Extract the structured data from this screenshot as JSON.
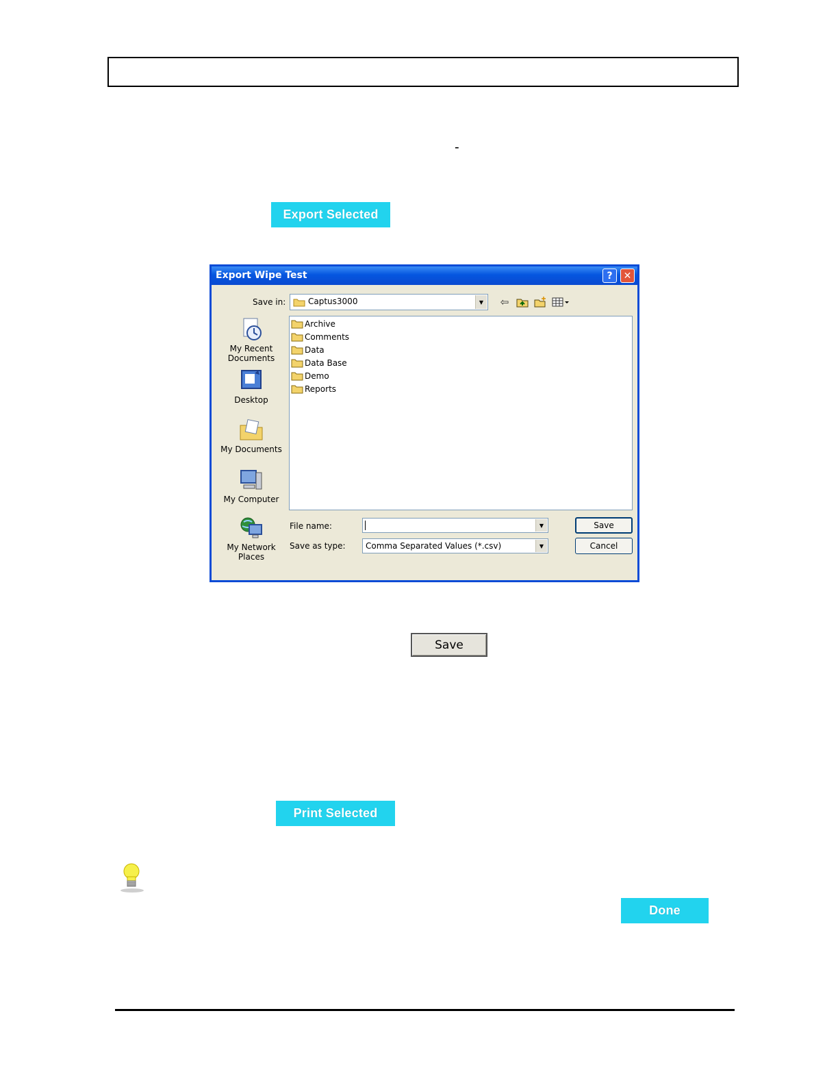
{
  "page": {
    "dash": "-",
    "export_selected_label": "Export Selected",
    "print_selected_label": "Print Selected",
    "done_label": "Done",
    "save_label": "Save"
  },
  "dialog": {
    "title": "Export Wipe Test",
    "help_glyph": "?",
    "close_glyph": "✕",
    "save_in_label": "Save in:",
    "save_in_value": "Captus3000",
    "places": [
      {
        "label": "My Recent Documents",
        "icon": "recent-documents-icon"
      },
      {
        "label": "Desktop",
        "icon": "desktop-icon"
      },
      {
        "label": "My Documents",
        "icon": "my-documents-icon"
      },
      {
        "label": "My Computer",
        "icon": "my-computer-icon"
      },
      {
        "label": "My Network Places",
        "icon": "network-places-icon"
      }
    ],
    "files": [
      "Archive",
      "Comments",
      "Data",
      "Data Base",
      "Demo",
      "Reports"
    ],
    "file_name_label": "File name:",
    "file_name_value": "",
    "save_as_type_label": "Save as type:",
    "save_as_type_value": "Comma Separated Values (*.csv)",
    "save_button": "Save",
    "cancel_button": "Cancel"
  }
}
